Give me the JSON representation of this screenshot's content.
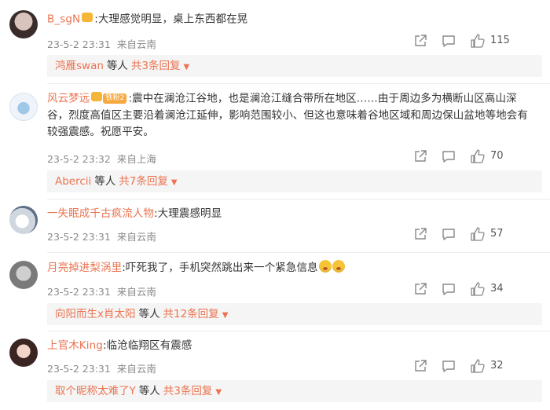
{
  "colors": {
    "accent": "#eb7350",
    "meta": "#8a8a8a",
    "reply_bg": "#f5f5f5"
  },
  "comments": [
    {
      "username": "B_sgN",
      "text": ":大理感觉明显，桌上东西都在晃",
      "date": "23-5-2 23:31",
      "location": "来自云南",
      "likes": "115",
      "badge": "crown",
      "reply": {
        "name": "鸿雁swan",
        "mid": "等人",
        "count": "共3条回复"
      }
    },
    {
      "username": "风云梦远",
      "text": ":震中在澜沧江谷地，也是澜沧江缝合带所在地区……由于周边多为横断山区高山深谷，烈度高值区主要沿着澜沧江延伸，影响范围较小、但这也意味着谷地区域和周边保山盆地等地会有较强震感。祝愿平安。",
      "date": "23-5-2 23:32",
      "location": "来自上海",
      "likes": "70",
      "badge": "crown",
      "badge_level": "铁粉2",
      "reply": {
        "name": "Abercii",
        "mid": "等人",
        "count": "共7条回复"
      }
    },
    {
      "username": "一失眠成千古疯流人物",
      "text": ":大理震感明显",
      "date": "23-5-2 23:31",
      "location": "来自云南",
      "likes": "57"
    },
    {
      "username": "月亮掉进梨涡里",
      "text": ":吓死我了，手机突然跳出来一个紧急信息",
      "date": "23-5-2 23:31",
      "location": "来自云南",
      "likes": "34",
      "emoji": "scared-face",
      "reply": {
        "name": "向阳而生x肖太阳",
        "mid": "等人",
        "count": "共12条回复"
      }
    },
    {
      "username": "上官木King",
      "text": ":临沧临翔区有震感",
      "date": "23-5-2 23:31",
      "location": "来自云南",
      "likes": "32",
      "reply": {
        "name": "取个昵称太难了Y",
        "mid": "等人",
        "count": "共3条回复"
      }
    }
  ]
}
